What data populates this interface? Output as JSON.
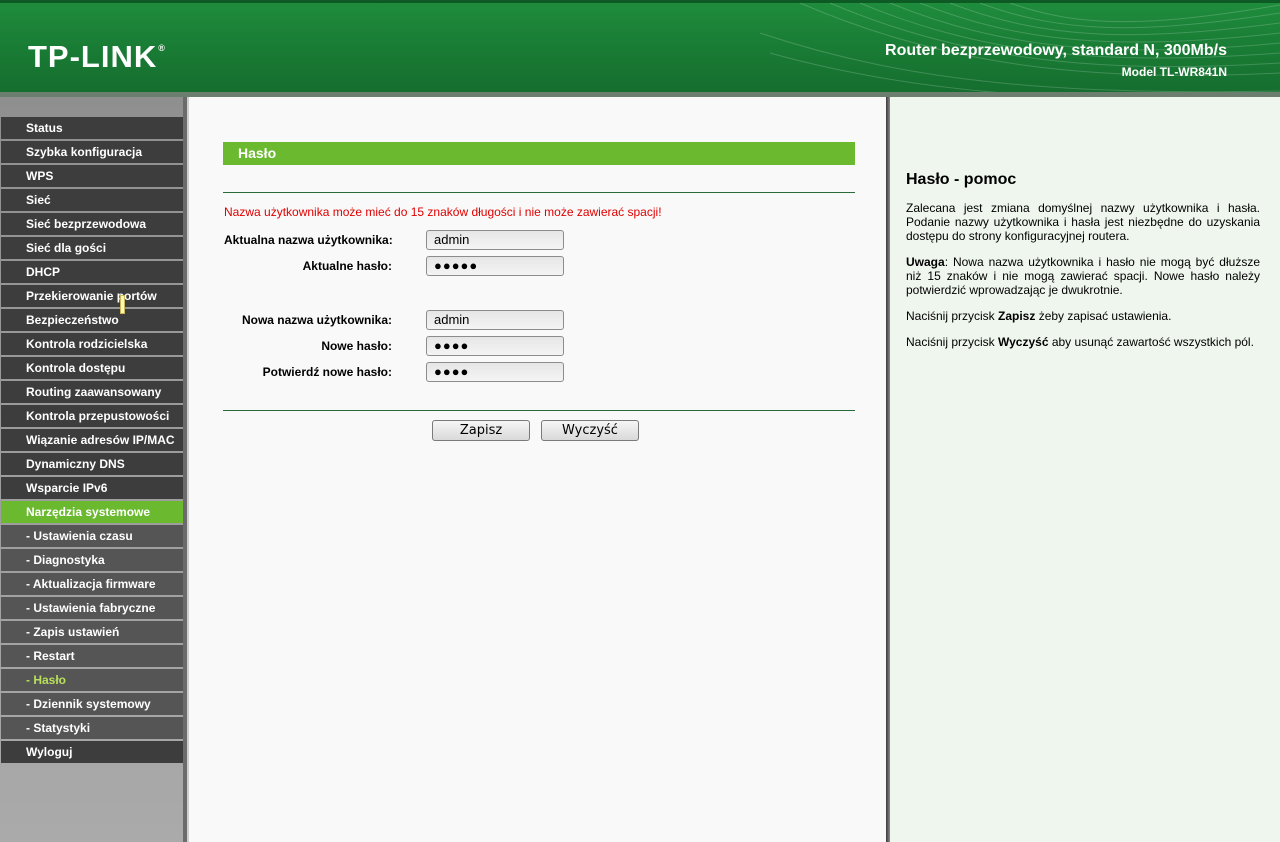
{
  "header": {
    "logo": "TP-LINK",
    "logo_mark": "®",
    "title": "Router bezprzewodowy, standard N, 300Mb/s",
    "model": "Model TL-WR841N"
  },
  "menu": [
    {
      "label": "Status",
      "type": "top"
    },
    {
      "label": "Szybka konfiguracja",
      "type": "top"
    },
    {
      "label": "WPS",
      "type": "top"
    },
    {
      "label": "Sieć",
      "type": "top"
    },
    {
      "label": "Sieć bezprzewodowa",
      "type": "top"
    },
    {
      "label": "Sieć dla gości",
      "type": "top"
    },
    {
      "label": "DHCP",
      "type": "top"
    },
    {
      "label": "Przekierowanie portów",
      "type": "top"
    },
    {
      "label": "Bezpieczeństwo",
      "type": "top"
    },
    {
      "label": "Kontrola rodzicielska",
      "type": "top"
    },
    {
      "label": "Kontrola dostępu",
      "type": "top"
    },
    {
      "label": "Routing zaawansowany",
      "type": "top"
    },
    {
      "label": "Kontrola przepustowości",
      "type": "top"
    },
    {
      "label": "Wiązanie adresów IP/MAC",
      "type": "top"
    },
    {
      "label": "Dynamiczny DNS",
      "type": "top"
    },
    {
      "label": "Wsparcie IPv6",
      "type": "top"
    },
    {
      "label": "Narzędzia systemowe",
      "type": "active-top"
    },
    {
      "label": "- Ustawienia czasu",
      "type": "sub"
    },
    {
      "label": "- Diagnostyka",
      "type": "sub"
    },
    {
      "label": "- Aktualizacja firmware",
      "type": "sub"
    },
    {
      "label": "- Ustawienia fabryczne",
      "type": "sub"
    },
    {
      "label": "- Zapis ustawień",
      "type": "sub"
    },
    {
      "label": "- Restart",
      "type": "sub"
    },
    {
      "label": "- Hasło",
      "type": "active-sub"
    },
    {
      "label": "- Dziennik systemowy",
      "type": "sub"
    },
    {
      "label": "- Statystyki",
      "type": "sub"
    },
    {
      "label": "Wyloguj",
      "type": "top"
    }
  ],
  "main": {
    "title": "Hasło",
    "warning": "Nazwa użytkownika może mieć do 15 znaków długości i nie może zawierać spacji!",
    "fields": {
      "current_user_label": "Aktualna nazwa użytkownika:",
      "current_user_value": "admin",
      "current_pw_label": "Aktualne hasło:",
      "current_pw_value": "●●●●●",
      "new_user_label": "Nowa nazwa użytkownika:",
      "new_user_value": "admin",
      "new_pw_label": "Nowe hasło:",
      "new_pw_value": "●●●●",
      "confirm_pw_label": "Potwierdź nowe hasło:",
      "confirm_pw_value": "●●●●"
    },
    "save_label": "Zapisz",
    "clear_label": "Wyczyść"
  },
  "help": {
    "title": "Hasło - pomoc",
    "p1": "Zalecana jest zmiana domyślnej nazwy użytkownika i hasła. Podanie nazwy użytkownika i hasła jest niezbędne do uzyskania dostępu do strony konfiguracyjnej routera.",
    "p2_bold": "Uwaga",
    "p2_rest": ": Nowa nazwa użytkownika i hasło nie mogą być dłuższe niż 15 znaków i nie mogą zawierać spacji. Nowe hasło należy potwierdzić wprowadzając je dwukrotnie.",
    "p3_pre": "Naciśnij przycisk ",
    "p3_bold": "Zapisz",
    "p3_post": " żeby zapisać ustawienia.",
    "p4_pre": "Naciśnij przycisk ",
    "p4_bold": "Wyczyść",
    "p4_post": " aby usunąć zawartość wszystkich pól."
  },
  "colors": {
    "header_green": "#1a7f36",
    "accent_green": "#6ab92f",
    "menu_dark": "#3d3d3d",
    "warning_red": "#e00000"
  }
}
